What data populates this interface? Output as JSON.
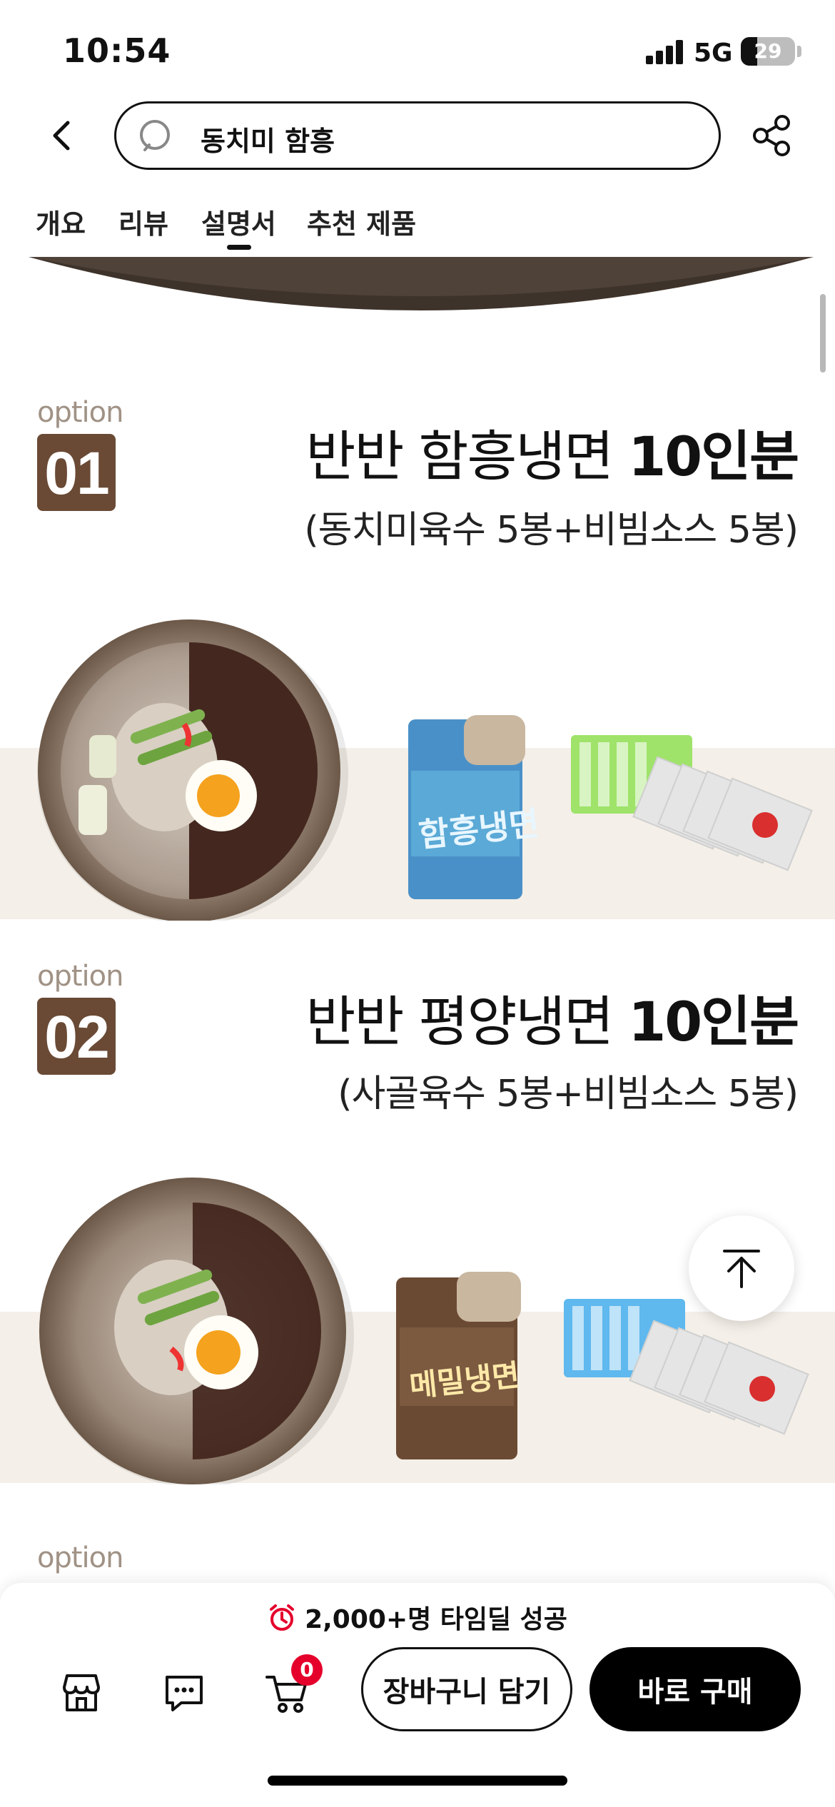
{
  "status": {
    "time": "10:54",
    "network": "5G",
    "battery": "29"
  },
  "search": {
    "query": "동치미 함흥"
  },
  "tabs": [
    {
      "label": "개요"
    },
    {
      "label": "리뷰"
    },
    {
      "label": "설명서"
    },
    {
      "label": "추천 제품"
    }
  ],
  "active_tab": "설명서",
  "options": [
    {
      "word": "option",
      "number": "01",
      "title_main": "반반 함흥냉면 ",
      "title_bold": "10인분",
      "subtitle": "(동치미육수 5봉+비빔소스 5봉)"
    },
    {
      "word": "option",
      "number": "02",
      "title_main": "반반 평양냉면 ",
      "title_bold": "10인분",
      "subtitle": "(사골육수 5봉+비빔소스 5봉)"
    },
    {
      "word": "option"
    }
  ],
  "bottom": {
    "deal_text": "2,000+명 타임딜 성공",
    "cart_count": "0",
    "add_to_cart_label": "장바구니 담기",
    "buy_now_label": "바로 구매"
  },
  "colors": {
    "badge_brown": "#6a4a35",
    "band_beige": "#f4efe8",
    "cart_badge_red": "#e5002b"
  }
}
